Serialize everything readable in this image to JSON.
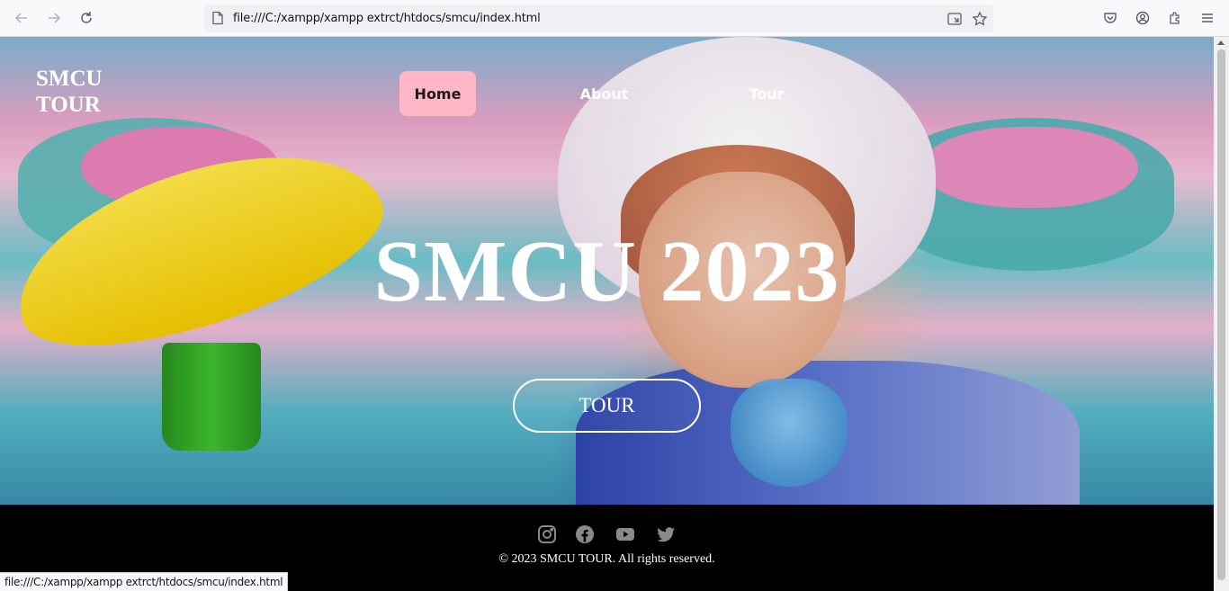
{
  "browser": {
    "url": "file:///C:/xampp/xampp extrct/htdocs/smcu/index.html",
    "status_url": "file:///C:/xampp/xampp extrct/htdocs/smcu/index.html"
  },
  "site": {
    "brand_line1": "SMCU",
    "brand_line2": "TOUR",
    "nav": [
      {
        "label": "Home",
        "active": true
      },
      {
        "label": "About",
        "active": false
      },
      {
        "label": "Tour",
        "active": false
      }
    ],
    "hero_title": "SMCU 2023",
    "hero_button": "TOUR",
    "footer": {
      "social": [
        "instagram-icon",
        "facebook-icon",
        "youtube-icon",
        "twitter-icon"
      ],
      "copyright": "© 2023 SMCU TOUR. All rights reserved."
    }
  },
  "colors": {
    "nav_active_bg": "#ffb6c6",
    "footer_bg": "#000000",
    "social_icon": "#8a8a8a"
  }
}
